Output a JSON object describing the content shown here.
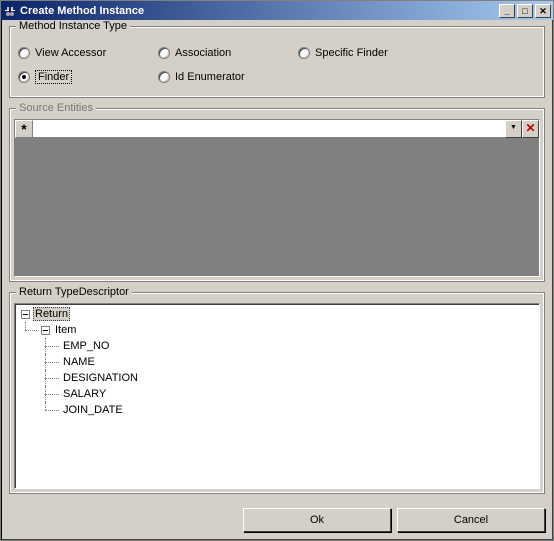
{
  "window": {
    "title": "Create Method Instance"
  },
  "method_instance_type": {
    "group_label": "Method Instance Type",
    "options": {
      "view_accessor": "View Accessor",
      "association": "Association",
      "specific_finder": "Specific Finder",
      "finder": "Finder",
      "id_enumerator": "Id Enumerator"
    },
    "selected": "finder"
  },
  "source_entities": {
    "group_label": "Source Entities",
    "new_row_marker": "*",
    "dropdown_glyph": "▼",
    "delete_glyph": "✕"
  },
  "return_type_descriptor": {
    "group_label": "Return TypeDescriptor",
    "root": "Return",
    "item": "Item",
    "fields": [
      "EMP_NO",
      "NAME",
      "DESIGNATION",
      "SALARY",
      "JOIN_DATE"
    ]
  },
  "buttons": {
    "ok": "Ok",
    "cancel": "Cancel"
  }
}
